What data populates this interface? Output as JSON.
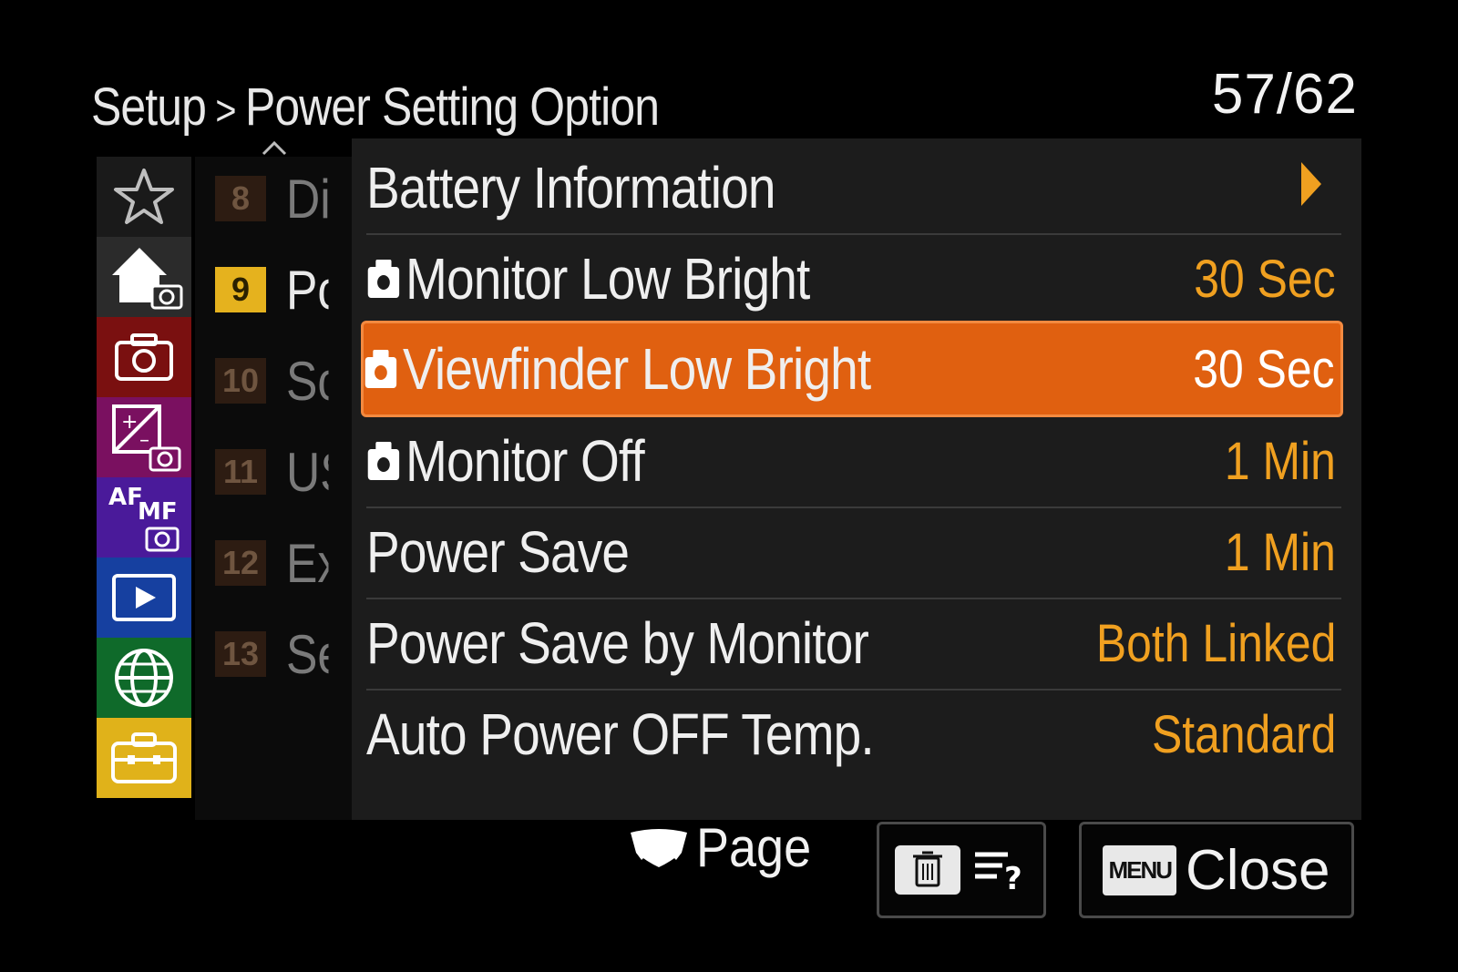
{
  "header": {
    "breadcrumb_root": "Setup",
    "breadcrumb_separator": ">",
    "breadcrumb_current": "Power Setting Option",
    "page_counter": "57/62"
  },
  "categories": [
    {
      "name": "favorites",
      "icon": "star-icon",
      "color": "#1a1a1a"
    },
    {
      "name": "main",
      "icon": "home-camera-icon",
      "color": "#2b2b2b"
    },
    {
      "name": "shooting",
      "icon": "camera-icon",
      "color": "#7a1010"
    },
    {
      "name": "exposure-color",
      "icon": "exposure-camera-icon",
      "color": "#7a1060"
    },
    {
      "name": "focus",
      "icon": "af-mf-icon",
      "color": "#4a1a9a"
    },
    {
      "name": "playback",
      "icon": "playback-icon",
      "color": "#1640a0"
    },
    {
      "name": "network",
      "icon": "globe-icon",
      "color": "#0f6a2a"
    },
    {
      "name": "setup",
      "icon": "toolbox-icon",
      "color": "#e0b21a"
    }
  ],
  "pages": [
    {
      "num": "8",
      "letter": "Di",
      "active": false
    },
    {
      "num": "9",
      "letter": "Pc",
      "active": true
    },
    {
      "num": "10",
      "letter": "Sc",
      "active": false
    },
    {
      "num": "11",
      "letter": "US",
      "active": false
    },
    {
      "num": "12",
      "letter": "Ex",
      "active": false
    },
    {
      "num": "13",
      "letter": "Se",
      "active": false
    }
  ],
  "menu": {
    "items": [
      {
        "label": "Battery Information",
        "value": "",
        "camera_icon": false,
        "submenu": true
      },
      {
        "label": "Monitor Low Bright",
        "value": "30 Sec",
        "camera_icon": true
      },
      {
        "label": "Viewfinder Low Bright",
        "value": "30 Sec",
        "camera_icon": true,
        "selected": true
      },
      {
        "label": "Monitor Off",
        "value": "1 Min",
        "camera_icon": true
      },
      {
        "label": "Power Save",
        "value": "1 Min",
        "camera_icon": false
      },
      {
        "label": "Power Save by Monitor",
        "value": "Both Linked",
        "camera_icon": false
      },
      {
        "label": "Auto Power OFF Temp.",
        "value": "Standard",
        "camera_icon": false
      }
    ]
  },
  "footer": {
    "page_label": "Page",
    "menu_badge": "MENU",
    "close_label": "Close"
  },
  "colors": {
    "accent_orange": "#e06010",
    "value_orange": "#f0a020",
    "page_active": "#e5b21e"
  }
}
